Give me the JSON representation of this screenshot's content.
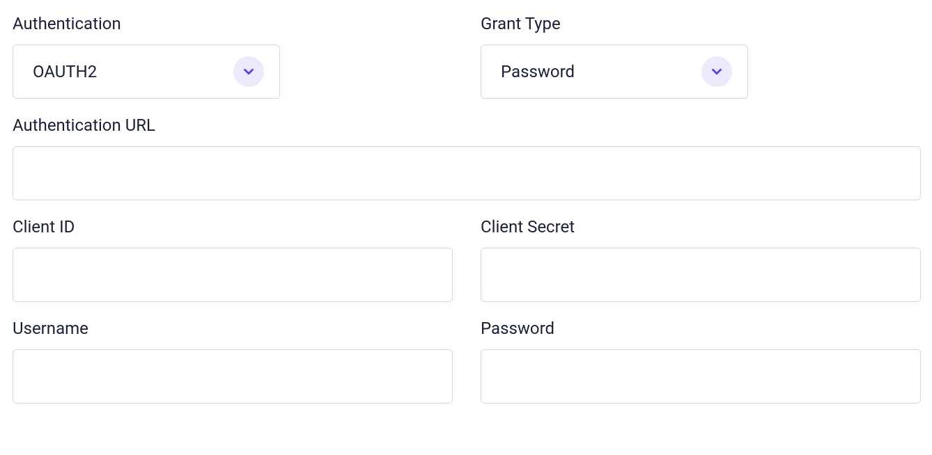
{
  "labels": {
    "authentication": "Authentication",
    "grant_type": "Grant Type",
    "auth_url": "Authentication URL",
    "client_id": "Client ID",
    "client_secret": "Client Secret",
    "username": "Username",
    "password": "Password"
  },
  "values": {
    "authentication": "OAUTH2",
    "grant_type": "Password",
    "auth_url": "",
    "client_id": "",
    "client_secret": "",
    "username": "",
    "password": ""
  }
}
